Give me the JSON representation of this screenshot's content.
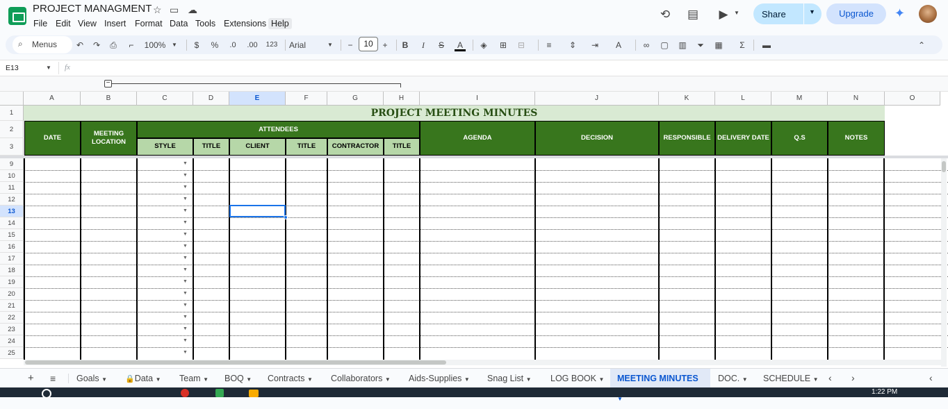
{
  "doc": {
    "title": "PROJECT MANAGMENT"
  },
  "menu": [
    "File",
    "Edit",
    "View",
    "Insert",
    "Format",
    "Data",
    "Tools",
    "Extensions",
    "Help"
  ],
  "header": {
    "share": "Share",
    "upgrade": "Upgrade"
  },
  "toolbar": {
    "menus": "Menus",
    "zoom": "100%",
    "currency": "$",
    "percent": "%",
    "dec_dec": ".0",
    "inc_dec": ".00",
    "num_format": "123",
    "font": "Arial",
    "font_size": "10",
    "sigma": "Σ"
  },
  "formula": {
    "cell_ref": "E13",
    "fx": "fx"
  },
  "columns": [
    "A",
    "B",
    "C",
    "D",
    "E",
    "F",
    "G",
    "H",
    "I",
    "J",
    "K",
    "L",
    "M",
    "N",
    "O"
  ],
  "rows": [
    "1",
    "2",
    "3",
    "9",
    "10",
    "11",
    "12",
    "13",
    "14",
    "15",
    "16",
    "17",
    "18",
    "19",
    "20",
    "21",
    "22",
    "23",
    "24",
    "25"
  ],
  "sheet": {
    "title": "PROJECT  MEETING MINUTES",
    "date": "DATE",
    "meeting_location": "MEETING LOCATION",
    "attendees": "ATTENDEES",
    "style": "STYLE",
    "title1": "TITLE",
    "client": "CLIENT",
    "title2": "TITLE",
    "contractor": "CONTRACTOR",
    "title3": "TITLE",
    "agenda": "AGENDA",
    "decision": "DECISION",
    "responsible": "RESPONSIBLE",
    "delivery_date": "DELIVERY DATE",
    "qs": "Q.S",
    "notes": "NOTES"
  },
  "tabs": [
    "Goals",
    "Data",
    "Team",
    "BOQ",
    "Contracts",
    "Collaborators",
    "Aids-Supplies",
    "Snag List",
    "LOG BOOK",
    "MEETING MINUTES",
    "DOC.",
    "SCHEDULE"
  ],
  "active_tab": "MEETING MINUTES",
  "clock": "1:22 PM",
  "colors": {
    "header_green": "#38761d",
    "sub_green": "#b6d7a8",
    "title_band": "#d9ead3",
    "accent": "#0b57d0"
  }
}
